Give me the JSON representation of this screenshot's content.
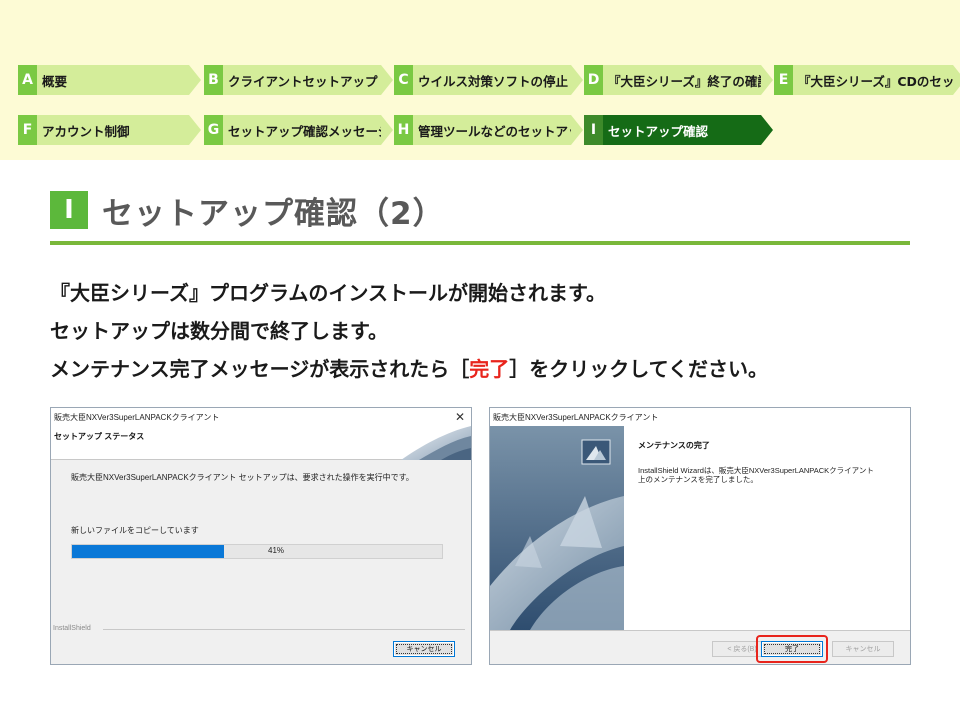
{
  "nav": {
    "row1": [
      {
        "letter": "A",
        "label": "概要"
      },
      {
        "letter": "B",
        "label": "クライアントセットアップ"
      },
      {
        "letter": "C",
        "label": "ウイルス対策ソフトの停止"
      },
      {
        "letter": "D",
        "label": "『大臣シリーズ』終了の確認"
      },
      {
        "letter": "E",
        "label": "『大臣シリーズ』CDのセット"
      }
    ],
    "row2": [
      {
        "letter": "F",
        "label": "アカウント制御"
      },
      {
        "letter": "G",
        "label": "セットアップ確認メッセージ"
      },
      {
        "letter": "H",
        "label": "管理ツールなどのセットアップ"
      },
      {
        "letter": "I",
        "label": "セットアップ確認",
        "active": true
      }
    ],
    "colors": {
      "light": "#d4ed9a",
      "letter": "#7ac943",
      "active": "#156b16"
    }
  },
  "heading": {
    "badge": "I",
    "title": "セットアップ確認（2）"
  },
  "body": {
    "line1": "『大臣シリーズ』プログラムのインストールが開始されます。",
    "line2": "セットアップは数分間で終了します。",
    "line3_prefix": "メンテナンス完了メッセージが表示されたら［",
    "line3_highlight": "完了",
    "line3_suffix": "］をクリックしてください。",
    "highlight_color": "#e8241c"
  },
  "dialog1": {
    "window_title": "販売大臣NXVer3SuperLANPACKクライアント",
    "close_icon": "close-icon",
    "header_title": "セットアップ ステータス",
    "message": "販売大臣NXVer3SuperLANPACKクライアント セットアップは、要求された操作を実行中です。",
    "sub_message": "新しいファイルをコピーしています",
    "progress_fraction": 0.41,
    "progress_label": "41%",
    "brand": "InstallShield",
    "cancel_label": "キャンセル"
  },
  "dialog2": {
    "window_title": "販売大臣NXVer3SuperLANPACKクライアント",
    "content_title": "メンテナンスの完了",
    "content_message_1": "InstallShield Wizardは、販売大臣NXVer3SuperLANPACKクライアント",
    "content_message_2": "上のメンテナンスを完了しました。",
    "back_label": "< 戻る(B)",
    "finish_label": "完了",
    "cancel_label": "キャンセル"
  }
}
